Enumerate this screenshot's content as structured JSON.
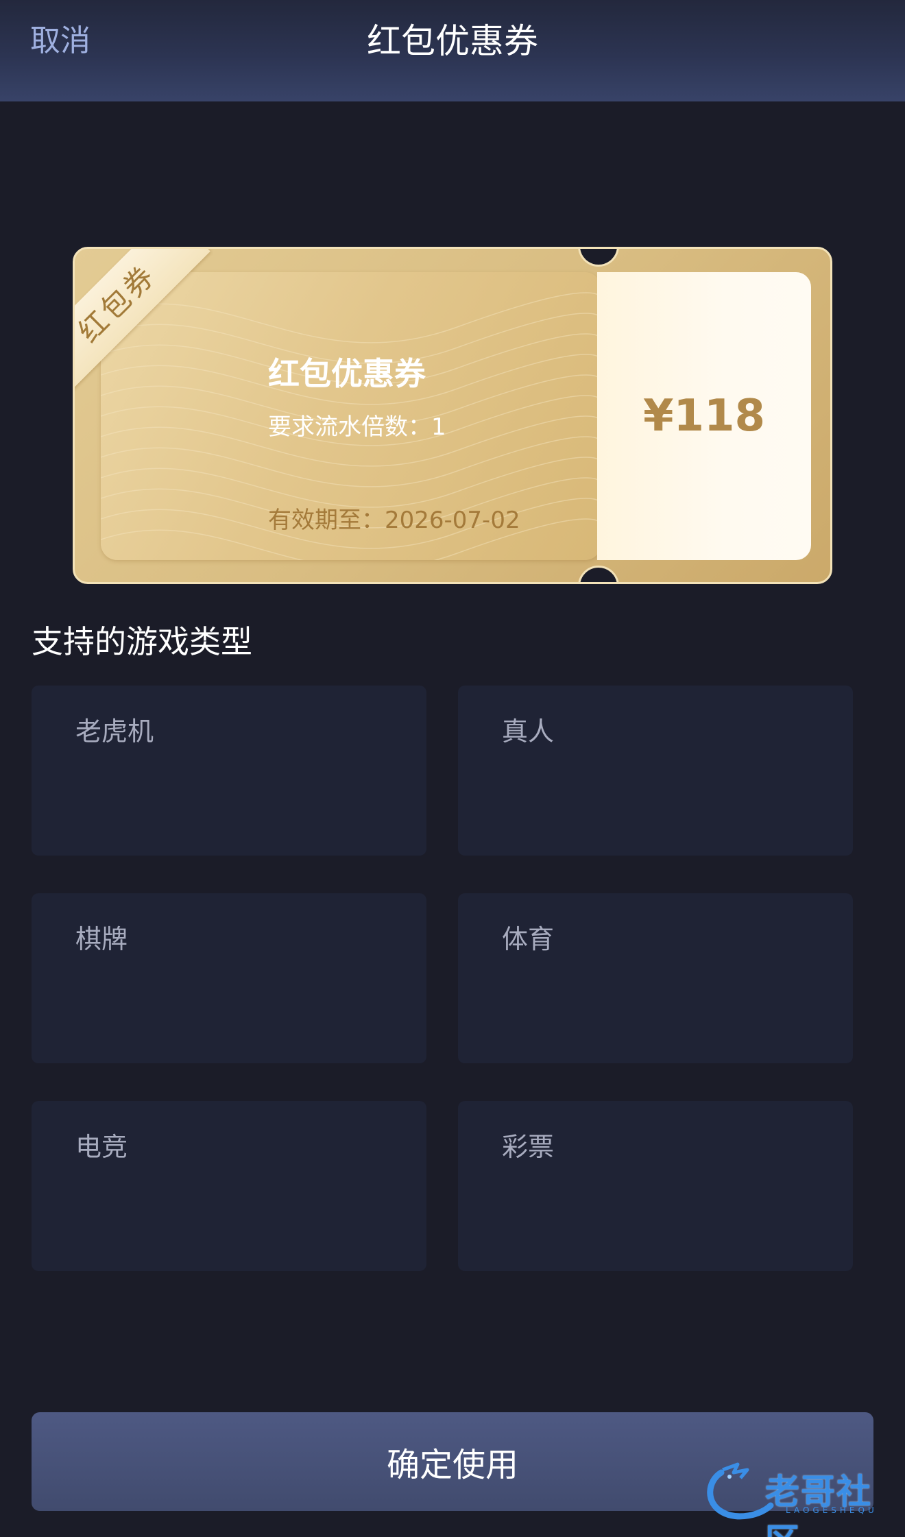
{
  "header": {
    "cancel_label": "取消",
    "title": "红包优惠券"
  },
  "coupon": {
    "ribbon_label": "红包券",
    "name": "红包优惠券",
    "requirement": "要求流水倍数：1",
    "expiry": "有效期至：2026-07-02",
    "amount": "¥118"
  },
  "section": {
    "title": "支持的游戏类型"
  },
  "games": [
    {
      "label": "老虎机"
    },
    {
      "label": "真人"
    },
    {
      "label": "棋牌"
    },
    {
      "label": "体育"
    },
    {
      "label": "电竞"
    },
    {
      "label": "彩票"
    }
  ],
  "confirm_label": "确定使用",
  "watermark": {
    "text": "老哥社区",
    "sub": "LAOGESHEQU"
  },
  "colors": {
    "background": "#1b1c28",
    "card": "#1f2335",
    "gold": "#b1894a",
    "button": "#475178"
  }
}
